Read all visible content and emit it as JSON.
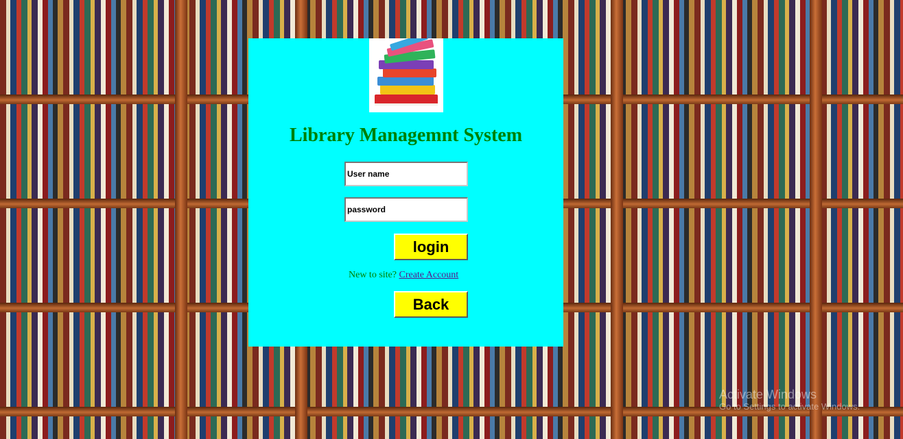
{
  "page": {
    "title": "Library Managemnt System"
  },
  "login_form": {
    "username_placeholder": "User name",
    "password_placeholder": "password",
    "login_label": "login",
    "signup_prompt": "New to site?",
    "create_account_label": "Create Account",
    "back_label": "Back"
  },
  "background": {
    "image": "bookshelf",
    "icon": "books-stack-icon"
  },
  "os_watermark": {
    "title": "Activate Windows",
    "subtitle": "Go to Settings to activate Windows."
  },
  "colors": {
    "panel": "#00ffff",
    "title": "#008000",
    "button": "#ffff00",
    "link": "#551a8b"
  }
}
